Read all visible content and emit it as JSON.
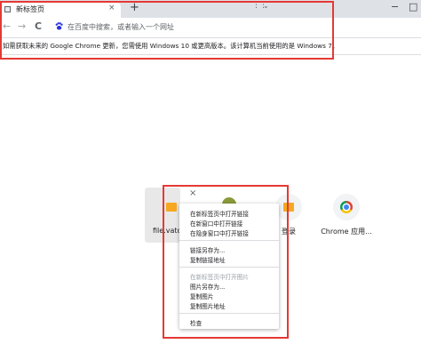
{
  "tab": {
    "title": "新标签页",
    "close": "×"
  },
  "tabstrip": {
    "new_tab": "+",
    "tab_search": "⋮⋮",
    "tab_search_chevron": "⌄",
    "minimize": "−",
    "maximize": "□"
  },
  "toolbar": {
    "back": "←",
    "forward": "→",
    "reload": "C",
    "omnibox_placeholder": "在百度中搜索，或者输入一个网址"
  },
  "infobar": {
    "message": "如需获取未来的 Google Chrome 更新，您需使用 Windows 10 或更高版本。该计算机当前使用的是 Windows 7。"
  },
  "shortcuts": [
    {
      "label": "file.vatc"
    },
    {
      "label": ""
    },
    {
      "label": "登录"
    },
    {
      "label": "Chrome 应用..."
    }
  ],
  "tile_close": "×",
  "context_menu": {
    "group1": [
      "在新标签页中打开链接",
      "在新窗口中打开链接",
      "在隐身窗口中打开链接"
    ],
    "group2": [
      "链接另存为...",
      "复制链接地址"
    ],
    "group3": [
      "在新标签页中打开图片",
      "图片另存为...",
      "复制图片",
      "复制图片地址"
    ],
    "group4": [
      "检查"
    ]
  },
  "colors": {
    "highlight_box": "#e53935",
    "folder": "#f6a821"
  }
}
